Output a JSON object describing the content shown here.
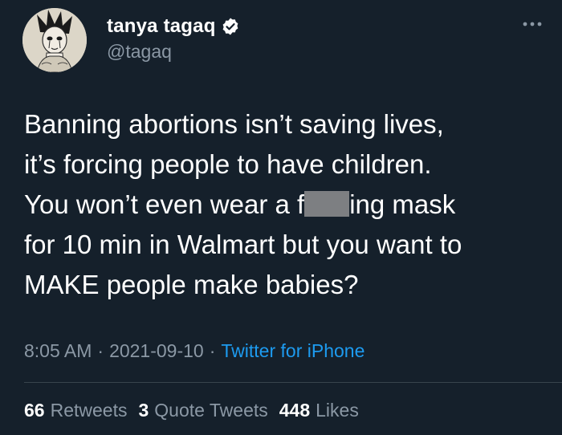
{
  "author": {
    "display_name": "tanya tagaq",
    "handle": "@tagaq",
    "verified": true
  },
  "tweet": {
    "line1": "Banning abortions isn’t saving lives,",
    "line2": "it’s forcing people to have children.",
    "line3_before": "You won’t even wear a f",
    "line3_after": "ing mask",
    "line4": "for 10 min in Walmart but you want to",
    "line5": "MAKE people make babies?"
  },
  "meta": {
    "time": "8:05 AM",
    "separator": "·",
    "date": "2021-09-10",
    "separator2": "·",
    "source": "Twitter for iPhone"
  },
  "stats": {
    "retweets_count": "66",
    "retweets_label": "Retweets",
    "quote_count": "3",
    "quote_label": "Quote Tweets",
    "likes_count": "448",
    "likes_label": "Likes"
  },
  "colors": {
    "background": "#15202b",
    "text": "#ffffff",
    "secondary": "#8b98a5",
    "link": "#1d9bf0",
    "divider": "#38444d"
  },
  "icons": {
    "verified": "verified-badge-icon",
    "more": "more-options-icon"
  }
}
